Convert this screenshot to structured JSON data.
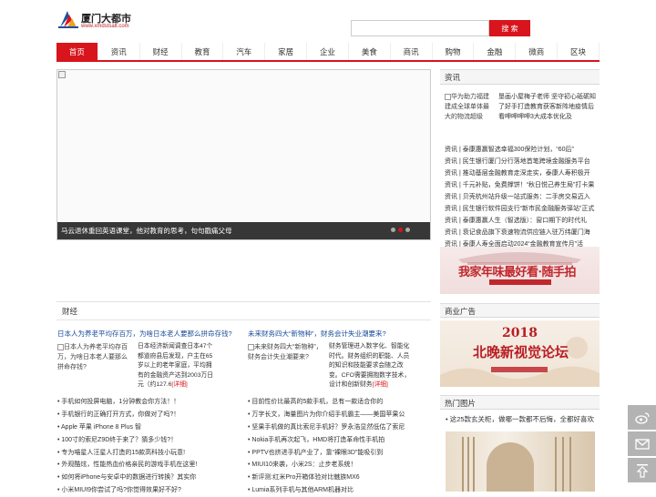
{
  "header": {
    "site_name": "厦门大都市",
    "site_url": "www.xmdstsalt.com",
    "search_placeholder": "",
    "search_label": "搜 索"
  },
  "nav": [
    "首页",
    "资讯",
    "财经",
    "教育",
    "汽车",
    "家居",
    "企业",
    "美食",
    "商讯",
    "购物",
    "金融",
    "微商",
    "区块"
  ],
  "slider": {
    "caption": "马云退休重回英语课堂，他对教育的思考，句句戳痛父母",
    "dots": 3,
    "active_dot": 1
  },
  "news": {
    "title": "资讯",
    "feature_img_alt": "华为助力福建建成全球单体最大的物流超级",
    "feature_text": "垦画小屋梅子老师 坚守初心砥砺知了好手打造教育获客新阵地疫情后看呷呷呷呷3大成本优化及",
    "items": [
      "资讯 | 泰康惠赢智选幸福300保险计划，“60后”",
      "资讯 | 民生银行厦门分行落地首笔跨境金融服务平台",
      "资讯 | 推动基层金融教育走深走实，泰康人寿积极开",
      "资讯 | 千元补贴，免费撑饼！“秋日悦己养生局”打卡果",
      "资讯 | 贝壳杭州站升级一站式服务：二手房交易迈入",
      "资讯 | 民生银行软件园支行“新市民金融服务驿站”正式",
      "资讯 | 泰康惠赢人生（智选版）：窗口期下的时代礼",
      "资讯 | 衰记食品旗下衰速物流供应链入驻万纬厦门海",
      "资讯 | 泰康人寿全面启动2024“金融教育宣传月”活"
    ]
  },
  "banner1": {
    "text": "我家年味最好看·随手拍"
  },
  "ad": {
    "title": "商业广告",
    "year": "2018",
    "text": "北晚新视觉论坛"
  },
  "hot": {
    "title": "热门图片",
    "item": "• 这25款玄关柜，做哪一款都不后悔，全都好喜欢"
  },
  "finance": {
    "title": "财经",
    "left": {
      "headline": "日本人为养老平均存百万，为啥日本老人要那么拼命存钱?",
      "img_alt": "日本人为养老平均存百万，为啥日本老人要那么拼命存钱?",
      "summary": "日本经济新闻调查日本47个都道府县后发现，户主在65岁以上的老年家庭，平均拥有的金融资产达到2003万日元（约127.6",
      "more": "[详细]"
    },
    "right": {
      "headline": "未来财务四大“新物种”，财务会计失业潮要来?",
      "img_alt": "未来财务四大“新物种”，财务会计失业潮要来?",
      "summary": "财务管理进入数字化、智能化时代。财务组织的职能、人员的知识和技能要求会随之改变。CFO需要拥抱数字技术，设计和创新财务",
      "more": "[详细]"
    },
    "left_list": [
      "• 手机如何投屏电脑，1分钟教会你方法！！",
      "• 手机银行的正确打开方式，你做对了吗?！",
      "• Apple 苹果 iPhone 8 Plus 智",
      "• 100寸的索尼Z9D终于来了？猜多少钱?！",
      "• 专为喵星人汪星人打造的15款高科技小玩意!",
      "• 外观酷炫，性能热血价格亲民的游戏手机在这里!",
      "• 如何将iPhone与安卓中的数据进行转换？其实你",
      "• 小米MIUI9你尝试了吗?你觉得效果好不好?"
    ],
    "right_list": [
      "• 目前性价比最高的5款手机，总有一款适合你的",
      "• 万字长文，海量图片为你介绍手机霸主——美国苹果公",
      "• 坚果手机做的真比索尼手机好？罗永浩显然低估了索尼",
      "• Nokia手机再次起飞，HMD将打造革命性手机拍",
      "• PPTV也挤进手机产业了，靠“裸眼3D”能吸引到",
      "• MIUI10来袭，小米2S：止步老系统！",
      "• 新评测:红米Pro开箱体验对比魅族MX6",
      "• Lumia系列手机与其他ARM机器对比"
    ]
  },
  "side_buttons": [
    "weibo-icon",
    "mail-icon",
    "back-to-top-icon"
  ],
  "colors": {
    "brand": "#d8141c",
    "link": "#1a4c9a"
  }
}
